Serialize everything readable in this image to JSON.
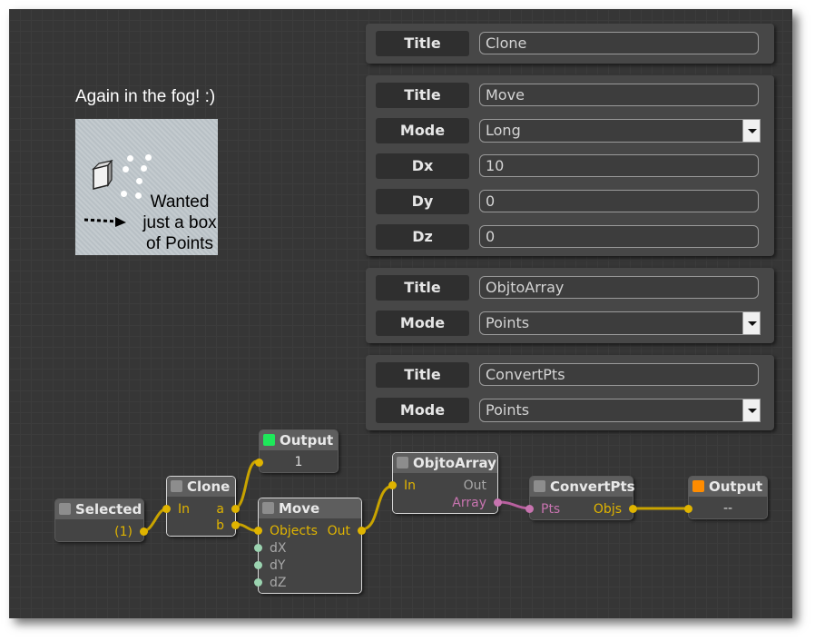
{
  "panels": [
    {
      "rows": [
        {
          "label": "Title",
          "value": "Clone"
        }
      ]
    },
    {
      "rows": [
        {
          "label": "Title",
          "value": "Move"
        },
        {
          "label": "Mode",
          "value": "Long"
        },
        {
          "label": "Dx",
          "value": "10"
        },
        {
          "label": "Dy",
          "value": "0"
        },
        {
          "label": "Dz",
          "value": "0"
        }
      ]
    },
    {
      "rows": [
        {
          "label": "Title",
          "value": "ObjtoArray"
        },
        {
          "label": "Mode",
          "value": "Points"
        }
      ]
    },
    {
      "rows": [
        {
          "label": "Title",
          "value": "ConvertPts"
        },
        {
          "label": "Mode",
          "value": "Points"
        }
      ]
    }
  ],
  "annotation": {
    "caption": "Again in the fog! :)",
    "text": "Wanted\njust a box\nof Points"
  },
  "nodes": {
    "selected": {
      "title": "Selected",
      "out": "(1)"
    },
    "clone": {
      "title": "Clone",
      "in": "In",
      "out_a": "a",
      "out_b": "b"
    },
    "output1": {
      "title": "Output",
      "value": "1"
    },
    "move": {
      "title": "Move",
      "in_objects": "Objects",
      "out": "Out",
      "in_dx": "dX",
      "in_dy": "dY",
      "in_dz": "dZ"
    },
    "objtoarray": {
      "title": "ObjtoArray",
      "in": "In",
      "out": "Out",
      "out_array": "Array"
    },
    "convertpts": {
      "title": "ConvertPts",
      "in": "Pts",
      "out": "Objs"
    },
    "output2": {
      "title": "Output",
      "value": "--"
    }
  },
  "colors": {
    "wire_yellow": "#c9a400",
    "wire_pink": "#b8609f",
    "output_green": "#1ee85a",
    "output_orange": "#ff8c00"
  }
}
